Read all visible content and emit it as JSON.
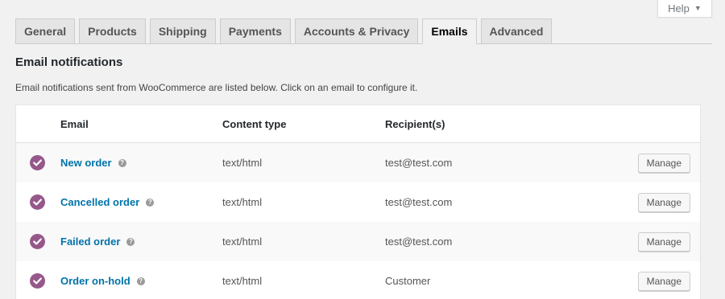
{
  "help": {
    "label": "Help",
    "caret": "▼"
  },
  "tabs": [
    {
      "label": "General"
    },
    {
      "label": "Products"
    },
    {
      "label": "Shipping"
    },
    {
      "label": "Payments"
    },
    {
      "label": "Accounts & Privacy"
    },
    {
      "label": "Emails",
      "active": true
    },
    {
      "label": "Advanced"
    }
  ],
  "section": {
    "title": "Email notifications",
    "description": "Email notifications sent from WooCommerce are listed below. Click on an email to configure it."
  },
  "table": {
    "headers": {
      "email": "Email",
      "content_type": "Content type",
      "recipients": "Recipient(s)"
    },
    "rows": [
      {
        "name": "New order",
        "content_type": "text/html",
        "recipient": "test@test.com",
        "action": "Manage",
        "enabled": true
      },
      {
        "name": "Cancelled order",
        "content_type": "text/html",
        "recipient": "test@test.com",
        "action": "Manage",
        "enabled": true
      },
      {
        "name": "Failed order",
        "content_type": "text/html",
        "recipient": "test@test.com",
        "action": "Manage",
        "enabled": true
      },
      {
        "name": "Order on-hold",
        "content_type": "text/html",
        "recipient": "Customer",
        "action": "Manage",
        "enabled": true
      }
    ]
  },
  "icons": {
    "status": "check-circle-icon",
    "help": "help-icon"
  },
  "colors": {
    "accent": "#96588a",
    "link": "#0073aa"
  }
}
